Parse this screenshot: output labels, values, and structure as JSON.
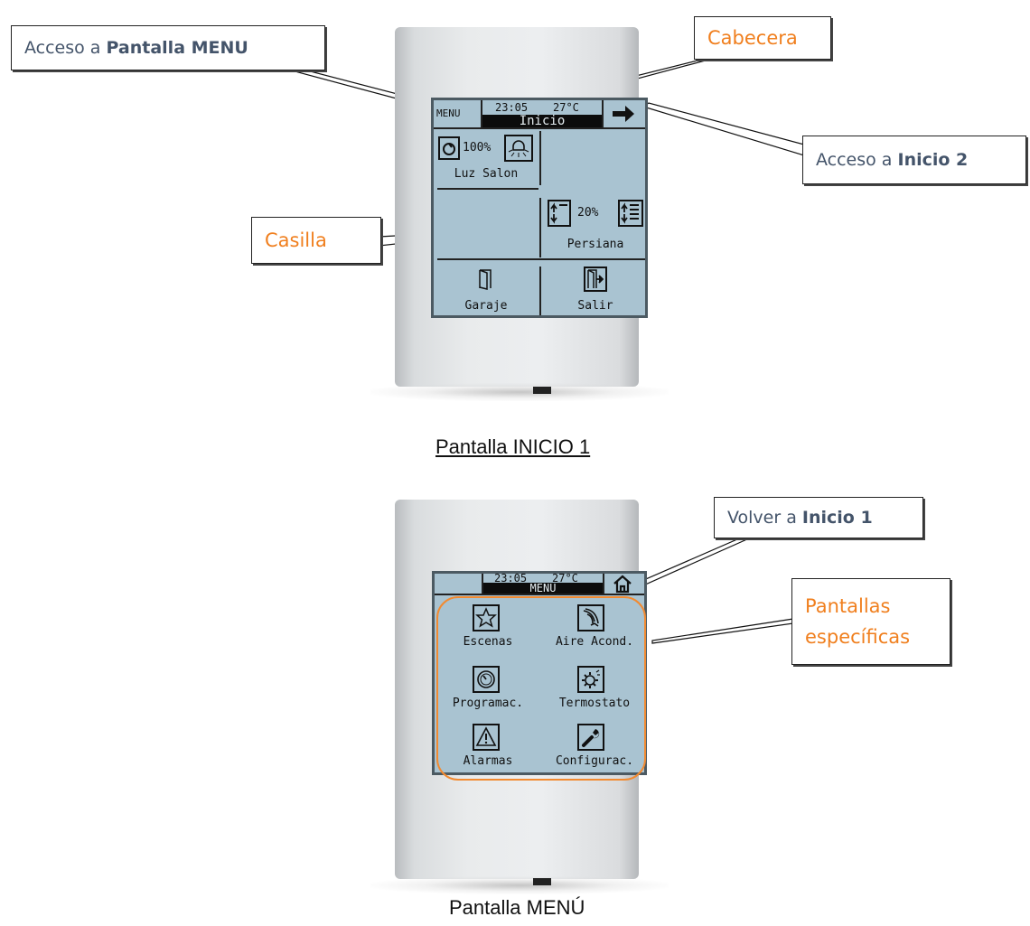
{
  "screen1": {
    "header": {
      "menu_label": "MENU",
      "time": "23:05",
      "temp": "27°C",
      "title": "Inicio"
    },
    "cells": {
      "luz": {
        "value": "100%",
        "label": "Luz Salon"
      },
      "persiana": {
        "value": "20%",
        "label": "Persiana"
      },
      "garaje": {
        "label": "Garaje"
      },
      "salir": {
        "label": "Salir"
      }
    },
    "caption": "Pantalla INICIO 1"
  },
  "screen2": {
    "header": {
      "time": "23:05",
      "temp": "27°C",
      "title": "MENU"
    },
    "items": {
      "escenas": "Escenas",
      "aire": "Aire Acond.",
      "programac": "Programac.",
      "termostato": "Termostato",
      "alarmas": "Alarmas",
      "configurac": "Configurac."
    },
    "caption": "Pantalla MENÚ"
  },
  "callouts": {
    "menu_access_prefix": "Acceso a ",
    "menu_access_bold": "Pantalla MENU",
    "cabecera": "Cabecera",
    "inicio2_prefix": "Acceso a ",
    "inicio2_bold": "Inicio 2",
    "casilla": "Casilla",
    "volver_prefix": "Volver a ",
    "volver_bold": "Inicio 1",
    "especificas_line1": "Pantallas",
    "especificas_line2": "específicas"
  },
  "colors": {
    "callout_text": "#44546a",
    "callout_orange": "#f07f1e",
    "lcd_bg": "#a9c3d1"
  }
}
